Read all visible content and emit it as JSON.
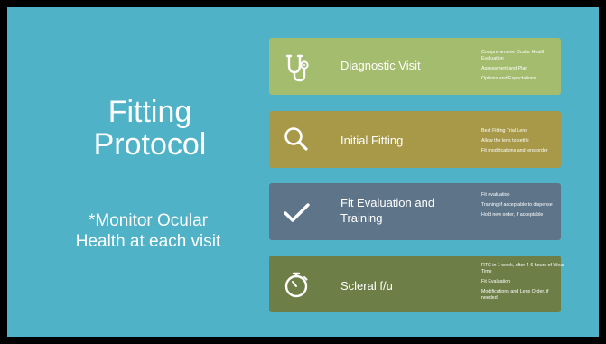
{
  "slide": {
    "title_line1": "Fitting",
    "title_line2": "Protocol",
    "subtitle_line1": "*Monitor Ocular",
    "subtitle_line2": "Health at each visit"
  },
  "cards": [
    {
      "label": "Diagnostic Visit",
      "icon": "stethoscope-icon",
      "color": "#a4bc6e",
      "details": [
        "Comprehensive Ocular Health Evaluation",
        "Assessment and Plan",
        "Options and Expectations"
      ]
    },
    {
      "label": "Initial Fitting",
      "icon": "magnifier-icon",
      "color": "#a79948",
      "details": [
        "Best Fitting Trial Lens",
        "Allow the lens to settle",
        "Fit modifications and lens order"
      ]
    },
    {
      "label_line1": "Fit Evaluation and",
      "label_line2": "Training",
      "icon": "checkmark-icon",
      "color": "#5e7589",
      "details": [
        "Fit evaluation",
        "Training if acceptable to dispense",
        "Hold new order, if acceptable"
      ]
    },
    {
      "label": "Scleral f/u",
      "icon": "stopwatch-icon",
      "color": "#6d7e46",
      "details": [
        "RTC in 1 week, after 4-6 hours of Wear Time",
        "Fit Evaluation",
        "Modifications and Lens Order, if needed"
      ]
    }
  ]
}
